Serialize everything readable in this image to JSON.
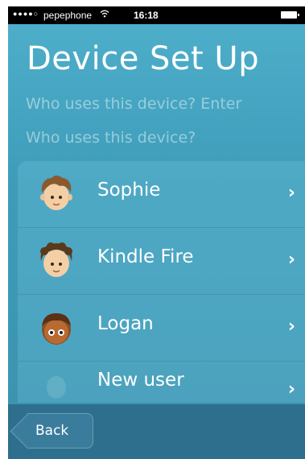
{
  "status_bar": {
    "signal": "●●●●○",
    "carrier": "pepephone",
    "time": "16:18"
  },
  "header": {
    "title": "Device Set Up",
    "subtitle_line1": "Who uses this device? Enter",
    "subtitle_line2": "Who uses this device?"
  },
  "users": [
    {
      "name": "Sophie",
      "icon": "avatar-boy-light-icon"
    },
    {
      "name": "Kindle Fire",
      "icon": "avatar-boy-curly-icon"
    },
    {
      "name": "Logan",
      "icon": "avatar-boy-dark-icon"
    },
    {
      "name": "New user",
      "icon": "new-user-icon"
    }
  ],
  "chevron": "›",
  "footer": {
    "back_label": "Back"
  },
  "colors": {
    "background": "#3e9cb9",
    "bottom_bar": "#2f6f8e",
    "text": "#ffffff"
  }
}
